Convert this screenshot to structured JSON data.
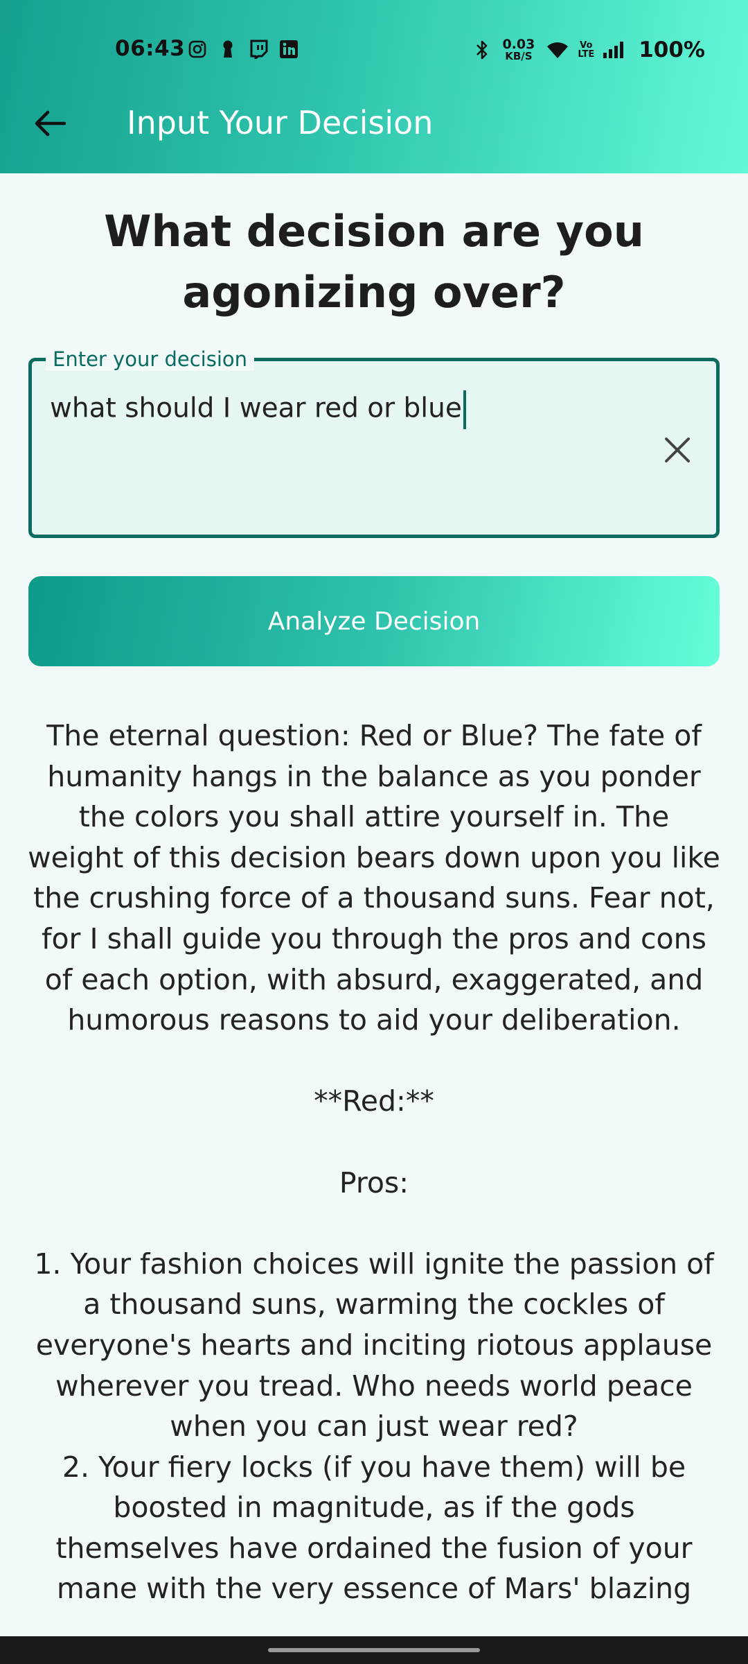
{
  "status_bar": {
    "time": "06:43",
    "net_speed_value": "0.03",
    "net_speed_unit": "KB/S",
    "volte_top": "Vo",
    "volte_bottom": "LTE",
    "battery": "100%",
    "notification_icons": [
      "instagram-icon",
      "keyhole-icon",
      "twitch-icon",
      "linkedin-icon"
    ],
    "system_icons": [
      "bluetooth-icon",
      "wifi-icon",
      "signal-icon"
    ]
  },
  "app_bar": {
    "title": "Input Your Decision",
    "back_icon": "arrow-left-icon",
    "gradient_start": "#15a08e",
    "gradient_end": "#63f9d8"
  },
  "main": {
    "question": "What decision are you agonizing over?",
    "input": {
      "label": "Enter your decision",
      "value": "what should I wear red or blue",
      "clear_icon": "close-icon",
      "border_color": "#0a6b61"
    },
    "analyze_button_label": "Analyze Decision",
    "response": {
      "intro": "The eternal question: Red or Blue? The fate of humanity hangs in the balance as you ponder the colors you shall attire yourself in. The weight of this decision bears down upon you like the crushing force of a thousand suns. Fear not, for I shall guide you through the pros and cons of each option, with absurd, exaggerated, and humorous reasons to aid your deliberation.",
      "red_heading": "**Red:**",
      "pros_heading": "Pros:",
      "pro_1": "1. Your fashion choices will ignite the passion of a thousand suns, warming the cockles of everyone's hearts and inciting riotous applause wherever you tread. Who needs world peace when you can just wear red?",
      "pro_2": "2. Your fiery locks (if you have them) will be boosted in magnitude, as if the gods themselves have ordained the fusion of your mane with the very essence of Mars' blazing"
    }
  }
}
